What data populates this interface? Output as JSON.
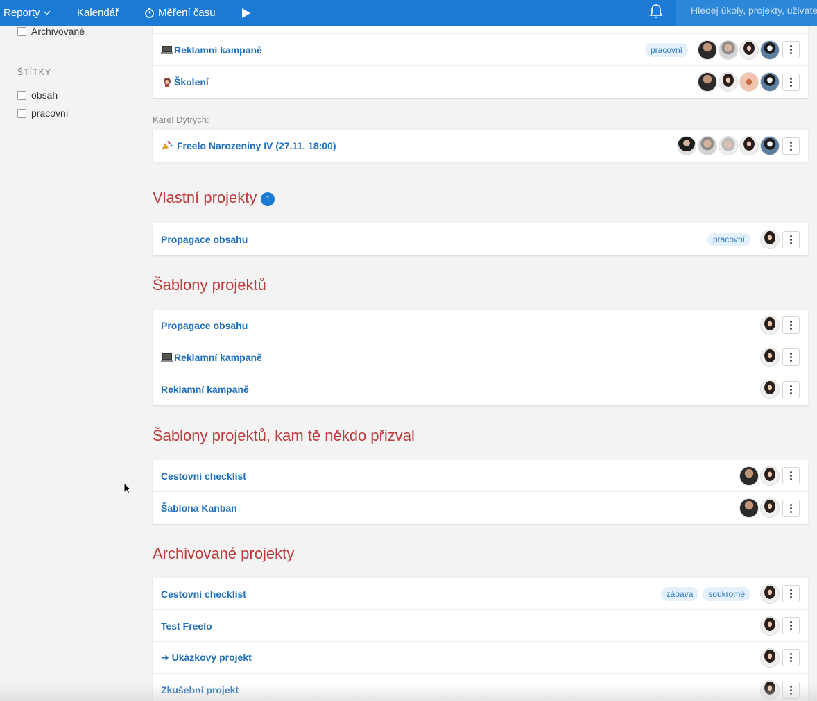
{
  "topbar": {
    "reports_label": "Reporty",
    "calendar_label": "Kalendář",
    "time_label": "Měření času",
    "search_placeholder": "Hledej úkoly, projekty, uživatele"
  },
  "sidebar": {
    "archived_label": "Archivované",
    "tags_heading": "ŠTÍTKY",
    "tags": [
      "obsah",
      "pracovní"
    ]
  },
  "top_card": [
    {
      "title": "Reklamní kampaně",
      "emoji": "laptop-icon",
      "tags": [
        "pracovní"
      ]
    },
    {
      "title": "Školení",
      "emoji": "teacher-icon",
      "tags": []
    }
  ],
  "karel": {
    "label": "Karel Dytrych:",
    "projects": [
      {
        "title": "Freelo Narozeniny IV (27.11. 18:00)",
        "emoji": "party-popper-icon"
      }
    ]
  },
  "own": {
    "title": "Vlastní projekty",
    "count": "1",
    "projects": [
      {
        "title": "Propagace obsahu",
        "tags": [
          "pracovní"
        ]
      }
    ]
  },
  "templates": {
    "title": "Šablony projektů",
    "projects": [
      {
        "title": "Propagace obsahu"
      },
      {
        "title": "Reklamní kampaně",
        "emoji": "laptop-icon"
      },
      {
        "title": "Reklamní kampaně"
      }
    ]
  },
  "invited_templates": {
    "title": "Šablony projektů, kam tě někdo přizval",
    "projects": [
      {
        "title": "Cestovní checklist"
      },
      {
        "title": "Šablona Kanban"
      }
    ]
  },
  "archived": {
    "title": "Archivované projekty",
    "projects": [
      {
        "title": "Cestovní checklist",
        "tags": [
          "zábava",
          "soukromé"
        ]
      },
      {
        "title": "Test Freelo"
      },
      {
        "title": "➔ Ukázkový projekt"
      },
      {
        "title": "Zkušební projekt"
      }
    ]
  },
  "colors": {
    "brand_blue": "#1a7ad4",
    "section_red": "#c0393b",
    "link_blue": "#1f6fbf"
  }
}
